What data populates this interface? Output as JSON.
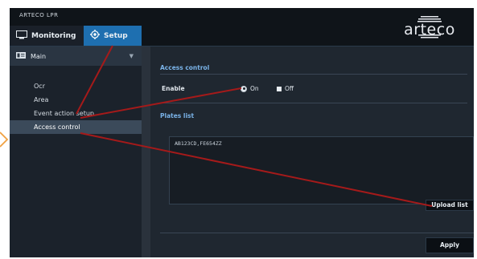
{
  "app": {
    "title": "ARTECO LPR",
    "logo_text": "arteco"
  },
  "tabs": [
    {
      "label": "Monitoring",
      "icon": "monitor-icon"
    },
    {
      "label": "Setup",
      "icon": "gear-icon"
    }
  ],
  "sidebar": {
    "header": {
      "label": "Main",
      "icon": "id-card-icon"
    },
    "items": [
      {
        "label": "Ocr"
      },
      {
        "label": "Area"
      },
      {
        "label": "Event action setup"
      },
      {
        "label": "Access control",
        "active": true
      }
    ]
  },
  "main": {
    "access_control": {
      "title": "Access control",
      "enable_label": "Enable",
      "on_label": "On",
      "off_label": "Off",
      "selected": "On"
    },
    "plates_list": {
      "title": "Plates list",
      "value": "AB123CD,FE654ZZ"
    },
    "upload_label": "Upload list",
    "apply_label": "Apply"
  },
  "colors": {
    "accent": "#1e6fb0",
    "annotation": "#a51a1a",
    "orange_arrow": "#f0a040"
  }
}
